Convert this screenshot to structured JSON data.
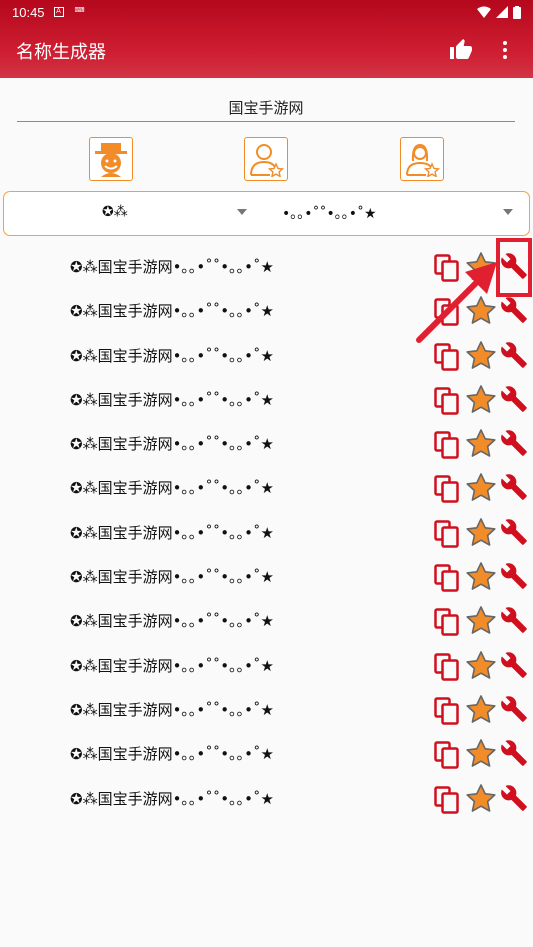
{
  "status_bar": {
    "time": "10:45"
  },
  "app_bar": {
    "title": "名称生成器"
  },
  "name_input": {
    "value": "国宝手游网"
  },
  "gender_buttons": [
    "clown-icon",
    "male-star-icon",
    "female-star-icon"
  ],
  "selector": {
    "left_value": "✪⁂",
    "right_value": "•｡｡•˚˚•｡｡•˚★"
  },
  "results": [
    {
      "text": "✪⁂国宝手游网•｡｡•˚˚•｡｡•˚★"
    },
    {
      "text": "✪⁂国宝手游网•｡｡•˚˚•｡｡•˚★"
    },
    {
      "text": "✪⁂国宝手游网•｡｡•˚˚•｡｡•˚★"
    },
    {
      "text": "✪⁂国宝手游网•｡｡•˚˚•｡｡•˚★"
    },
    {
      "text": "✪⁂国宝手游网•｡｡•˚˚•｡｡•˚★"
    },
    {
      "text": "✪⁂国宝手游网•｡｡•˚˚•｡｡•˚★"
    },
    {
      "text": "✪⁂国宝手游网•｡｡•˚˚•｡｡•˚★"
    },
    {
      "text": "✪⁂国宝手游网•｡｡•˚˚•｡｡•˚★"
    },
    {
      "text": "✪⁂国宝手游网•｡｡•˚˚•｡｡•˚★"
    },
    {
      "text": "✪⁂国宝手游网•｡｡•˚˚•｡｡•˚★"
    },
    {
      "text": "✪⁂国宝手游网•｡｡•˚˚•｡｡•˚★"
    },
    {
      "text": "✪⁂国宝手游网•｡｡•˚˚•｡｡•˚★"
    },
    {
      "text": "✪⁂国宝手游网•｡｡•˚˚•｡｡•˚★"
    }
  ],
  "colors": {
    "app_bar": "#c8102e",
    "accent_orange": "#f28c28",
    "icon_red": "#d0101e",
    "annotation_red": "#e02030"
  }
}
